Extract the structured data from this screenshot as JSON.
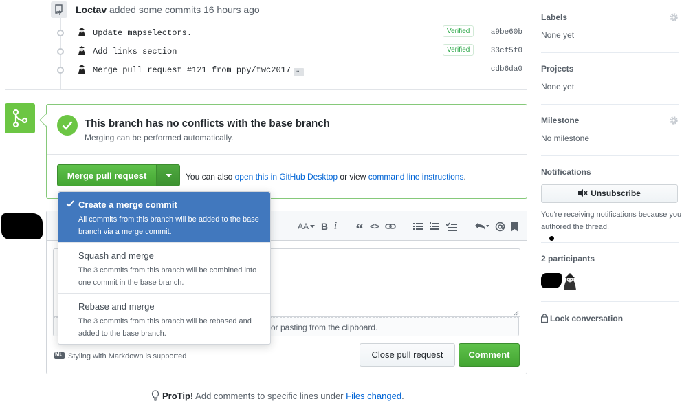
{
  "timeline": {
    "author": "Loctav",
    "action": "added some commits",
    "time": "16 hours ago",
    "commits": [
      {
        "message": "Update mapselectors.",
        "badge": "Verified",
        "sha": "a9be60b"
      },
      {
        "message": "Add links section",
        "badge": "Verified",
        "sha": "33cf5f0"
      },
      {
        "message": "Merge pull request #121 from ppy/twc2017",
        "expander": "…",
        "sha": "cdb6da0"
      }
    ]
  },
  "merge": {
    "title": "This branch has no conflicts with the base branch",
    "subtitle": "Merging can be performed automatically.",
    "button": "Merge pull request",
    "also_prefix": "You can also",
    "desktop_link": "open this in GitHub Desktop",
    "or_view": "or view",
    "cli_link": "command line instructions",
    "period": "."
  },
  "merge_menu": [
    {
      "title": "Create a merge commit",
      "description": "All commits from this branch will be added to the base branch via a merge commit.",
      "selected": true
    },
    {
      "title": "Squash and merge",
      "description": "The 3 commits from this branch will be combined into one commit in the base branch.",
      "selected": false
    },
    {
      "title": "Rebase and merge",
      "description": "The 3 commits from this branch will be rebased and added to the base branch.",
      "selected": false
    }
  ],
  "comment": {
    "toolbar": {
      "heading": "AA",
      "bold": "B",
      "italic": "i",
      "quote": "“",
      "code": "<>"
    },
    "attach_text": "or pasting from the clipboard.",
    "markdown_note": "Styling with Markdown is supported",
    "close_button": "Close pull request",
    "comment_button": "Comment"
  },
  "sidebar": {
    "labels": {
      "heading": "Labels",
      "value": "None yet"
    },
    "projects": {
      "heading": "Projects",
      "value": "None yet"
    },
    "milestone": {
      "heading": "Milestone",
      "value": "No milestone"
    },
    "notifications": {
      "heading": "Notifications",
      "button": "Unsubscribe",
      "text": "You're receiving notifications because you authored the thread."
    },
    "participants": {
      "heading": "2 participants"
    },
    "lock": "Lock conversation"
  },
  "protip": {
    "label": "ProTip!",
    "text": "Add comments to specific lines under",
    "link": "Files changed",
    "period": "."
  },
  "colors": {
    "green": "#6cc644",
    "link": "#0366d6",
    "selected": "#4178be",
    "verified": "#28a745"
  }
}
